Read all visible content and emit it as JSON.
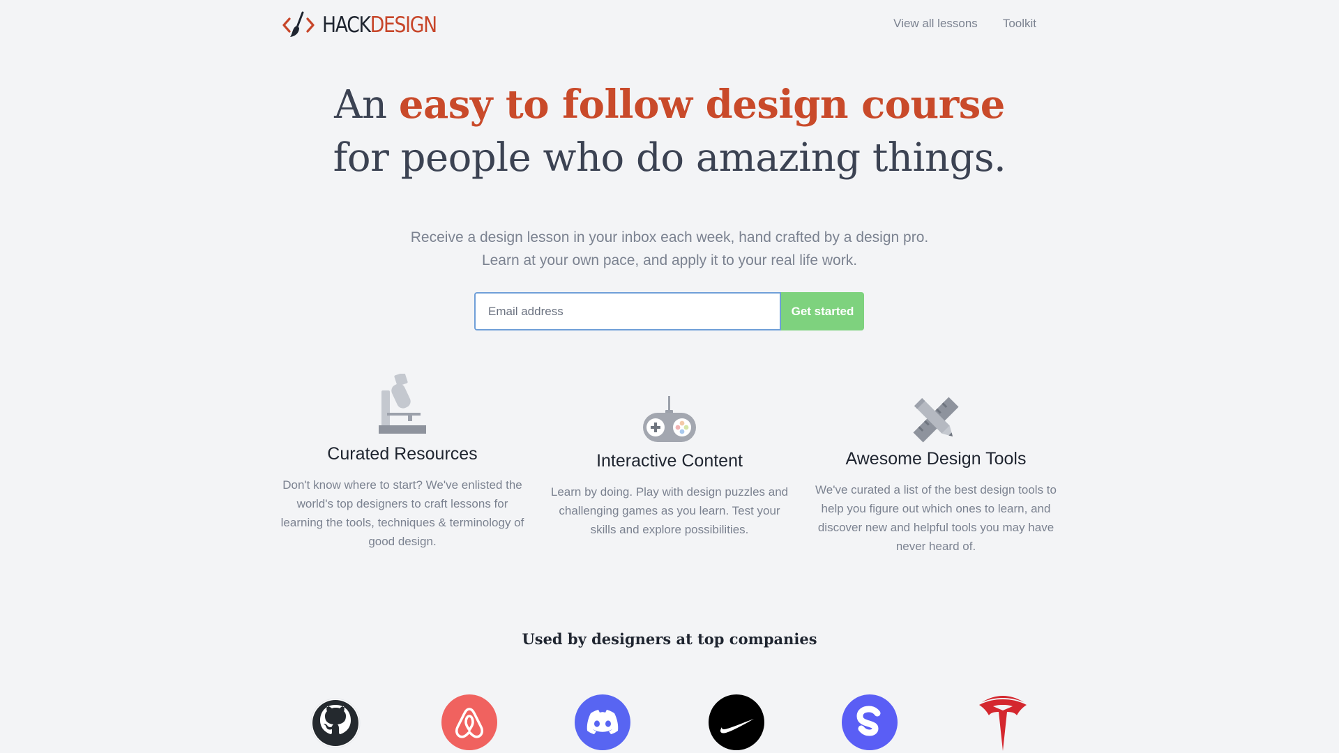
{
  "header": {
    "logo": {
      "hack": "HACK",
      "design": "DESIGN"
    },
    "nav": [
      {
        "label": "View all lessons"
      },
      {
        "label": "Toolkit"
      }
    ]
  },
  "hero": {
    "line1_prefix": "An ",
    "line1_accent": "easy to follow design course",
    "line2": "for people who do amazing things."
  },
  "subtitle": {
    "line1": "Receive a design lesson in your inbox each week, hand crafted by a design pro.",
    "line2": "Learn at your own pace, and apply it to your real life work."
  },
  "signup": {
    "email_placeholder": "Email address",
    "email_value": "",
    "button_label": "Get started"
  },
  "features": [
    {
      "icon": "microscope-icon",
      "title": "Curated Resources",
      "description": "Don't know where to start? We've enlisted the world's top designers to craft lessons for learning the tools, techniques & terminology of good design."
    },
    {
      "icon": "gamepad-icon",
      "title": "Interactive Content",
      "description": "Learn by doing. Play with design puzzles and challenging games as you learn. Test your skills and explore possibilities."
    },
    {
      "icon": "ruler-pencil-icon",
      "title": "Awesome Design Tools",
      "description": "We've curated a list of the best design tools to help you figure out which ones to learn, and discover new and helpful tools you may have never heard of."
    }
  ],
  "companies": {
    "heading": "Used by designers at top companies",
    "logos": [
      {
        "name": "github-logo",
        "color": "#24292e"
      },
      {
        "name": "airbnb-logo",
        "color": "#f0625f"
      },
      {
        "name": "discord-logo",
        "color": "#5865f2"
      },
      {
        "name": "nike-logo",
        "color": "#000000"
      },
      {
        "name": "skillshare-logo",
        "color": "#5a5ef5"
      },
      {
        "name": "tesla-logo",
        "color": "#d4272e"
      }
    ]
  },
  "colors": {
    "accent": "#c94a2a",
    "button": "#7ed27e",
    "background": "#f3f4f6",
    "input_border": "#6f9fd8"
  }
}
